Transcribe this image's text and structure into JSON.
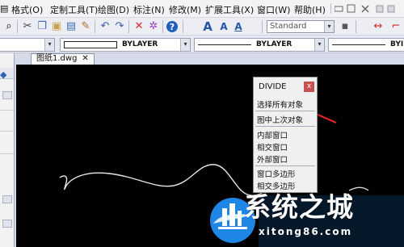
{
  "menu": {
    "items": [
      "格式(O)",
      "定制工具(T)",
      "绘图(D)",
      "标注(N)",
      "修改(M)",
      "扩展工具(X)",
      "窗口(W)",
      "帮助(H)"
    ],
    "right_icon": "window-controls-icon"
  },
  "toolbar": {
    "text_style": "Standard",
    "text_style_arrow": "▾",
    "text_glyph_large": "A",
    "text_glyph_small": "A",
    "text_glyph_underlined": "A"
  },
  "properties": {
    "layer_value": "BYLAYER",
    "linetype_value": "BYLAYER",
    "lineweight_value": "BYI",
    "combo_arrow": "▾"
  },
  "document": {
    "tab_label": "图纸1.dwg",
    "tab_close": "✕"
  },
  "divide_popup": {
    "title": "DIVIDE",
    "close": "x",
    "options": [
      "选择所有对象",
      "图中上次对象",
      "内部窗口",
      "相交窗口",
      "外部窗口",
      "窗口多边形",
      "相交多边形"
    ]
  },
  "watermark": {
    "title": "系统之城",
    "url": "xitong86.com"
  },
  "colors": {
    "canvas": "#000000",
    "annotation_arrow": "#e0242a",
    "watermark_blue": "#1e86e4"
  }
}
